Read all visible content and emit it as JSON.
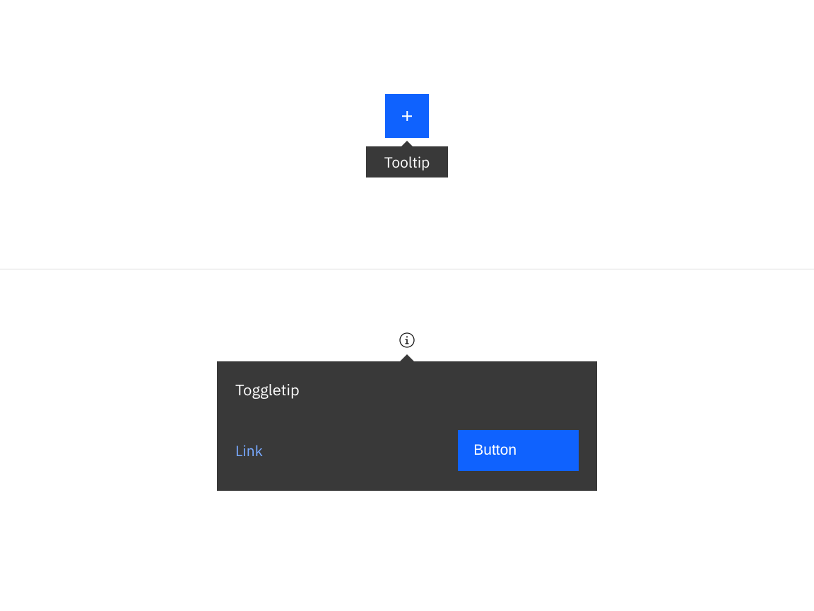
{
  "tooltip_section": {
    "tooltip_text": "Tooltip"
  },
  "toggletip_section": {
    "title": "Toggletip",
    "link_text": "Link",
    "button_text": "Button"
  },
  "colors": {
    "primary": "#0f62fe",
    "tooltip_bg": "#393939",
    "link": "#78a9ff"
  }
}
